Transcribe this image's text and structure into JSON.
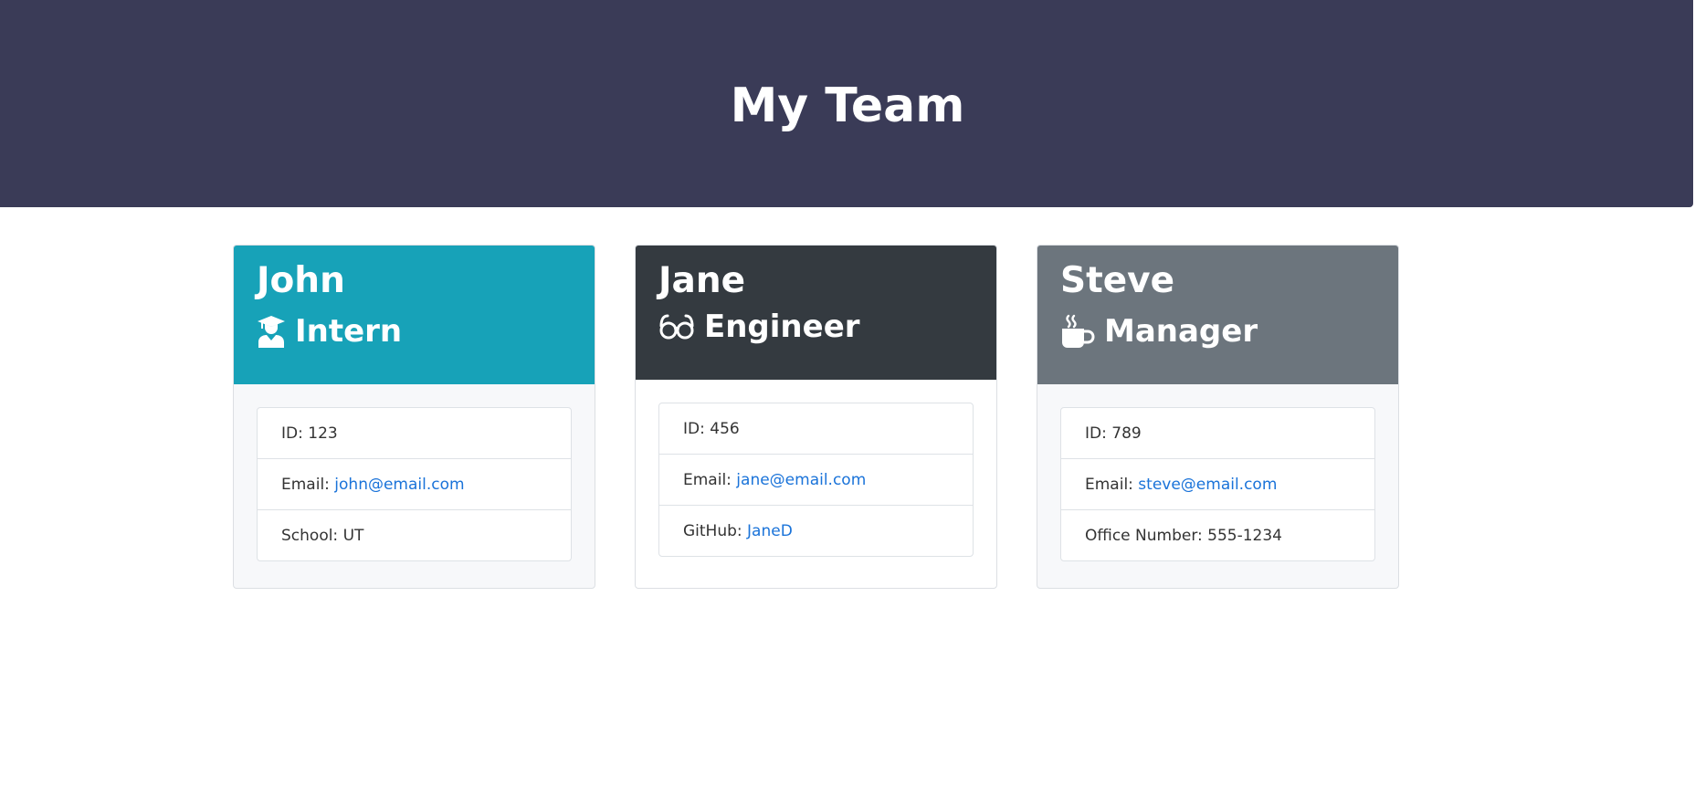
{
  "header": {
    "title": "My Team"
  },
  "colors": {
    "header_bg": "#3a3b57",
    "intern": "#17a2b8",
    "engineer": "#343a40",
    "manager": "#6c757d",
    "link": "#1a73d9"
  },
  "cards": [
    {
      "name": "John",
      "role": "Intern",
      "icon": "graduate-icon",
      "rows": [
        {
          "label": "ID: ",
          "value": "123"
        },
        {
          "label": "Email: ",
          "value": "john@email.com"
        },
        {
          "label": "School: ",
          "value": "UT"
        }
      ]
    },
    {
      "name": "Jane",
      "role": "Engineer",
      "icon": "glasses-icon",
      "rows": [
        {
          "label": "ID: ",
          "value": "456"
        },
        {
          "label": "Email: ",
          "value": "jane@email.com"
        },
        {
          "label": "GitHub: ",
          "value": "JaneD"
        }
      ]
    },
    {
      "name": "Steve",
      "role": "Manager",
      "icon": "coffee-mug-icon",
      "rows": [
        {
          "label": "ID: ",
          "value": "789"
        },
        {
          "label": "Email: ",
          "value": "steve@email.com"
        },
        {
          "label": "Office Number: ",
          "value": "555-1234"
        }
      ]
    }
  ]
}
